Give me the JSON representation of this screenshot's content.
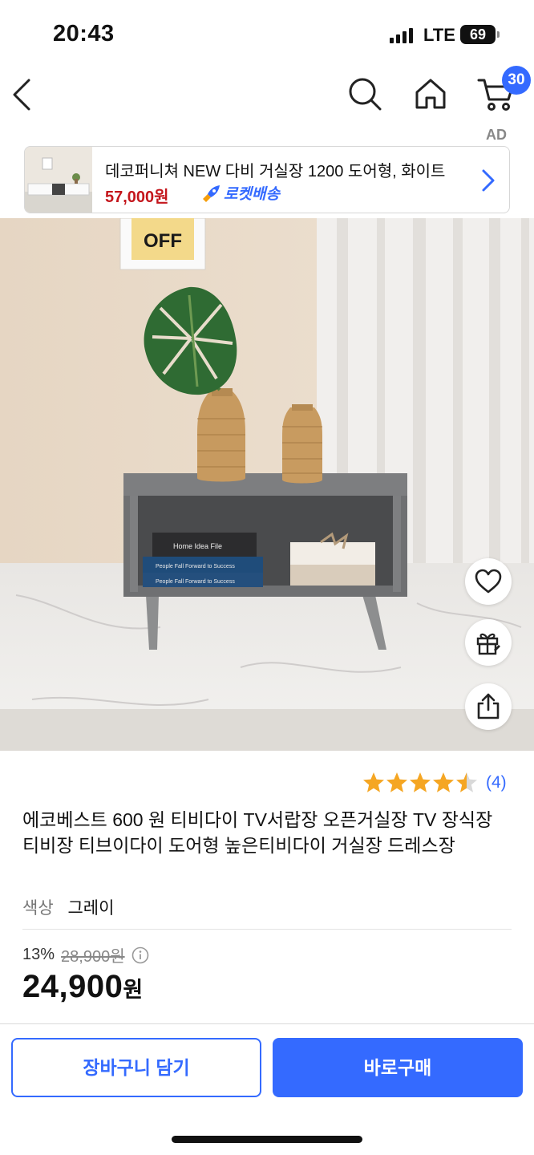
{
  "status_bar": {
    "time": "20:43",
    "network": "LTE",
    "battery": "69"
  },
  "nav": {
    "back_icon": "chevron-left-icon",
    "search_icon": "search-icon",
    "home_icon": "home-icon",
    "cart_icon": "cart-icon",
    "cart_count": "30"
  },
  "ad": {
    "label": "AD",
    "title": "데코퍼니쳐 NEW 다비 거실장 1200 도어형, 화이트",
    "price": "57,000원",
    "delivery": "로켓배송"
  },
  "hero": {
    "book1": "Home Idea File",
    "book2": "People Fall Forward to Success",
    "book3": "People Fall Forward to Success",
    "poster": "OFF"
  },
  "rating": {
    "stars": 4.5,
    "count": "(4)"
  },
  "product": {
    "title": "에코베스트 600 원 티비다이 TV서랍장 오픈거실장 TV 장식장 티비장 티브이다이 도어형 높은티비다이 거실장 드레스장",
    "option_label": "색상",
    "option_value": "그레이",
    "discount": "13%",
    "original_price": "28,900원",
    "sale_price": "24,900",
    "sale_unit": "원"
  },
  "actions": {
    "add_to_cart": "장바구니 담기",
    "buy_now": "바로구매"
  },
  "colors": {
    "accent": "#346aff",
    "ad_price": "#c4161c",
    "star": "#f5a623"
  }
}
